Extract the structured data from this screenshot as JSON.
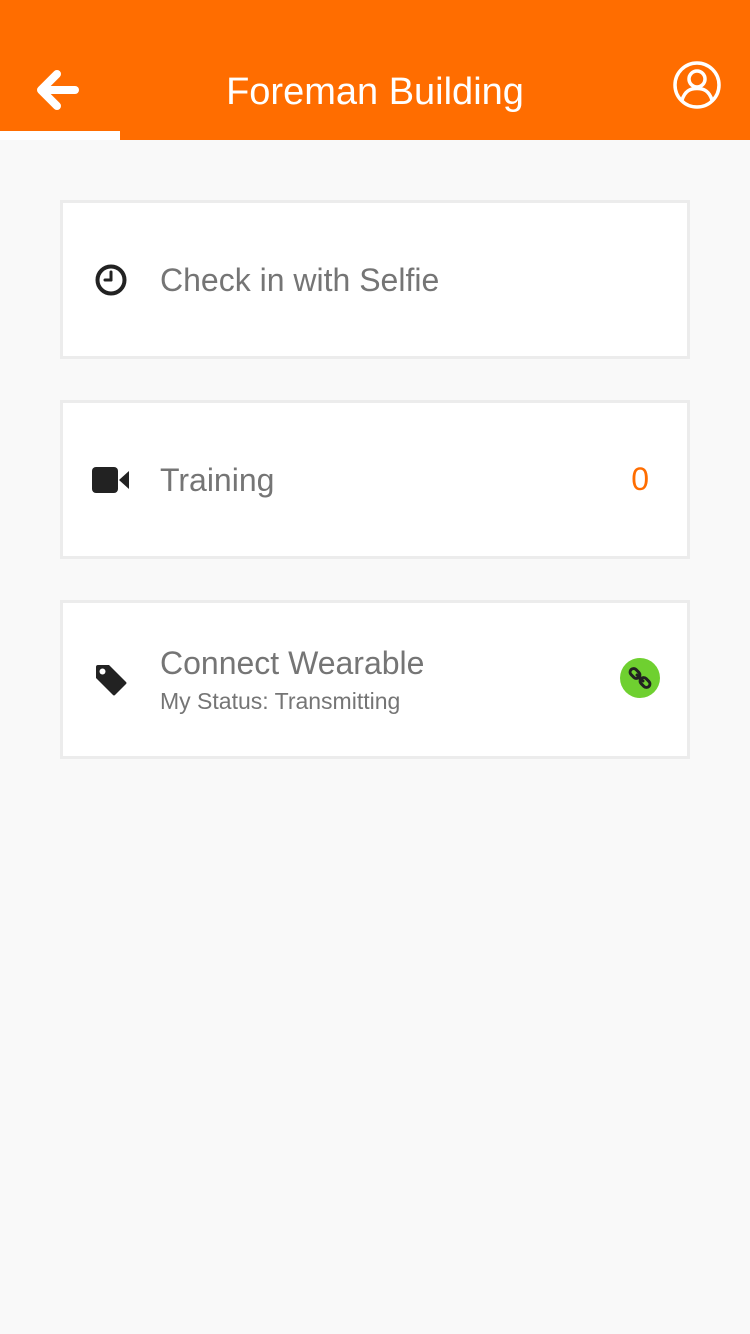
{
  "header": {
    "title": "Foreman Building",
    "back_icon": "arrow-left-icon",
    "profile_icon": "user-circle-icon",
    "background_color": "#ff6d00"
  },
  "menu": {
    "check_in": {
      "label": "Check in with Selfie",
      "icon": "clock-icon"
    },
    "training": {
      "label": "Training",
      "icon": "video-camera-icon",
      "count": "0",
      "count_color": "#ff6d00"
    },
    "wearable": {
      "label": "Connect Wearable",
      "status_text": "My Status: Transmitting",
      "icon": "tag-icon",
      "status_icon": "link-icon",
      "status_color": "#6fd030"
    }
  }
}
